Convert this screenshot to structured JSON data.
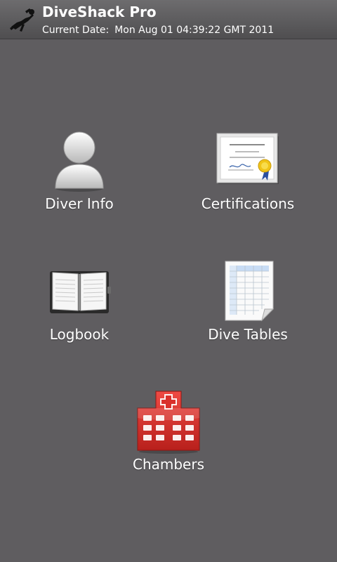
{
  "header": {
    "app_title": "DiveShack Pro",
    "date_label": "Current Date:",
    "date_value": "Mon Aug 01 04:39:22 GMT 2011",
    "logo_icon": "scuba-diver-icon"
  },
  "menu": {
    "diver_info": {
      "label": "Diver Info",
      "icon": "person-icon"
    },
    "certifications": {
      "label": "Certifications",
      "icon": "certificate-icon"
    },
    "logbook": {
      "label": "Logbook",
      "icon": "open-book-icon"
    },
    "dive_tables": {
      "label": "Dive Tables",
      "icon": "spreadsheet-icon"
    },
    "chambers": {
      "label": "Chambers",
      "icon": "hospital-icon"
    }
  },
  "colors": {
    "background": "#5f5d60",
    "header": "#5a595b",
    "text": "#ffffff",
    "hospital_red": "#d9302c"
  }
}
